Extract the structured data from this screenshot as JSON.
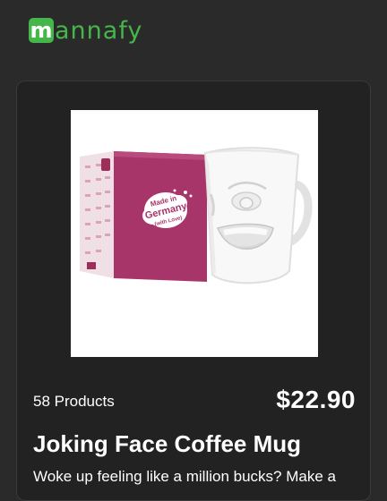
{
  "brand": {
    "logo_letter": "m",
    "logo_rest": "annafy",
    "color": "#45b649"
  },
  "product": {
    "image_alt": "Joking face coffee mug with pink box",
    "box_label_line1": "Made in",
    "box_label_line2": "Germany",
    "box_label_line3": "(with Love)",
    "count_text": "58 Products",
    "price": "$22.90",
    "title": "Joking Face Coffee Mug",
    "description": "Woke up feeling like a million bucks? Make a"
  }
}
